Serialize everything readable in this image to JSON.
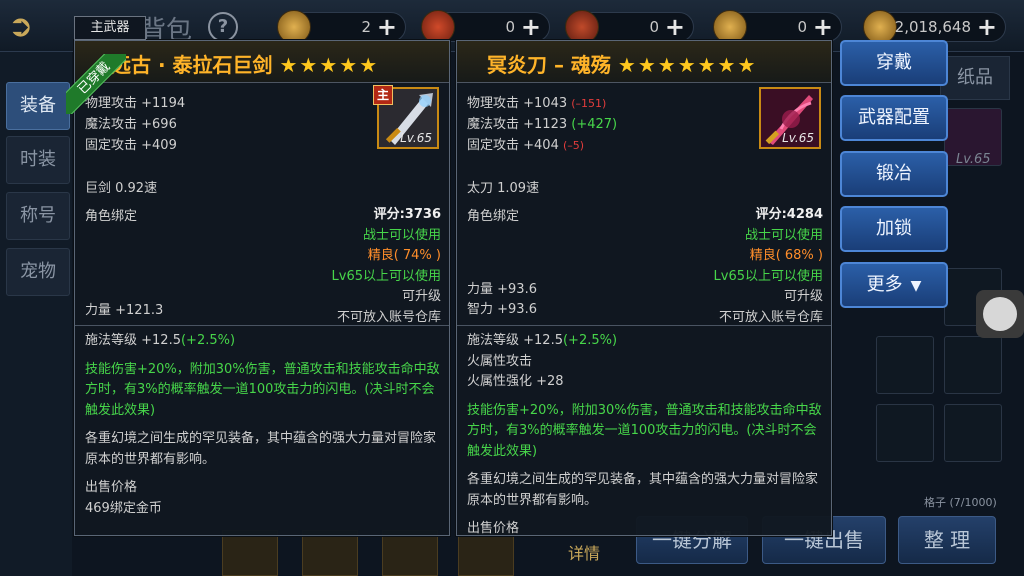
{
  "background": {
    "title": "背包",
    "help": "?",
    "currencies": [
      {
        "value": "2",
        "plus": "+"
      },
      {
        "value": "0",
        "plus": "+"
      },
      {
        "value": "0",
        "plus": "+"
      },
      {
        "value": "0",
        "plus": "+"
      },
      {
        "value": "2,018,648",
        "plus": "+"
      }
    ],
    "side_tabs": [
      "装备",
      "时装",
      "称号",
      "宠物"
    ],
    "right_tab": "纸品",
    "slot_lv": "Lv.65",
    "slots_count": "格子 (7/1000)",
    "bottom_buttons": [
      "一键分解",
      "一键出售",
      "整 理"
    ],
    "detail": "详情",
    "thumb_lv": "Lv.65"
  },
  "left_item": {
    "tag": "主武器",
    "equipped": "已穿戴",
    "name": "远古 · 泰拉石巨剑",
    "stars": "★★★★★",
    "stats": [
      "物理攻击 +1194",
      "魔法攻击 +696",
      "固定攻击 +409"
    ],
    "main_badge": "主",
    "level": "Lv.65",
    "speed": "巨剑 0.92速",
    "bind": "角色绑定",
    "score": "评分:3736",
    "class_req": "战士可以使用",
    "quality": "精良( 74% )",
    "level_req": "Lv65以上可以使用",
    "upgrade": "可升级",
    "no_storage": "不可放入账号仓库",
    "strength": "力量 +121.3",
    "cast_level": "施法等级 +12.5",
    "cast_bonus": "(+2.5%)",
    "skill_effect": "技能伤害+20%，附加30%伤害，普通攻击和技能攻击命中敌方时，有3%的概率触发一道100攻击力的闪电。(决斗时不会触发此效果)",
    "flavor": "各重幻境之间生成的罕见装备，其中蕴含的强大力量对冒险家原本的世界都有影响。",
    "sell_label": "出售价格",
    "sell_price": "469绑定金币"
  },
  "right_item": {
    "name": "冥炎刀 – 魂殇",
    "stars": "★★★★★★★",
    "stats": [
      {
        "text": "物理攻击 +1043 ",
        "diff": "(–151)",
        "diff_type": "red"
      },
      {
        "text": "魔法攻击 +1123 ",
        "diff": "(+427)",
        "diff_type": "green"
      },
      {
        "text": "固定攻击 +404 ",
        "diff": "(–5)",
        "diff_type": "red"
      }
    ],
    "level": "Lv.65",
    "speed": "太刀 1.09速",
    "bind": "角色绑定",
    "score": "评分:4284",
    "class_req": "战士可以使用",
    "quality": "精良( 68% )",
    "level_req": "Lv65以上可以使用",
    "upgrade": "可升级",
    "no_storage": "不可放入账号仓库",
    "strength": "力量 +93.6",
    "intellect": "智力 +93.6",
    "cast_level": "施法等级 +12.5",
    "cast_bonus": "(+2.5%)",
    "fire_attack": "火属性攻击",
    "fire_boost": "火属性强化 +28",
    "skill_effect": "技能伤害+20%，附加30%伤害，普通攻击和技能攻击命中敌方时，有3%的概率触发一道100攻击力的闪电。(决斗时不会触发此效果)",
    "flavor": "各重幻境之间生成的罕见装备，其中蕴含的强大力量对冒险家原本的世界都有影响。",
    "sell_label": "出售价格"
  },
  "actions": {
    "wear": "穿戴",
    "weapon_config": "武器配置",
    "forge": "锻冶",
    "lock": "加锁",
    "more": "更多",
    "more_arrow": "▼"
  },
  "colors": {
    "name_gold": "#ffb429",
    "green_text": "#47d64a",
    "orange_text": "#ff8e2a",
    "red_diff": "#e23c3c",
    "button_blue": "#2b5fa8"
  }
}
